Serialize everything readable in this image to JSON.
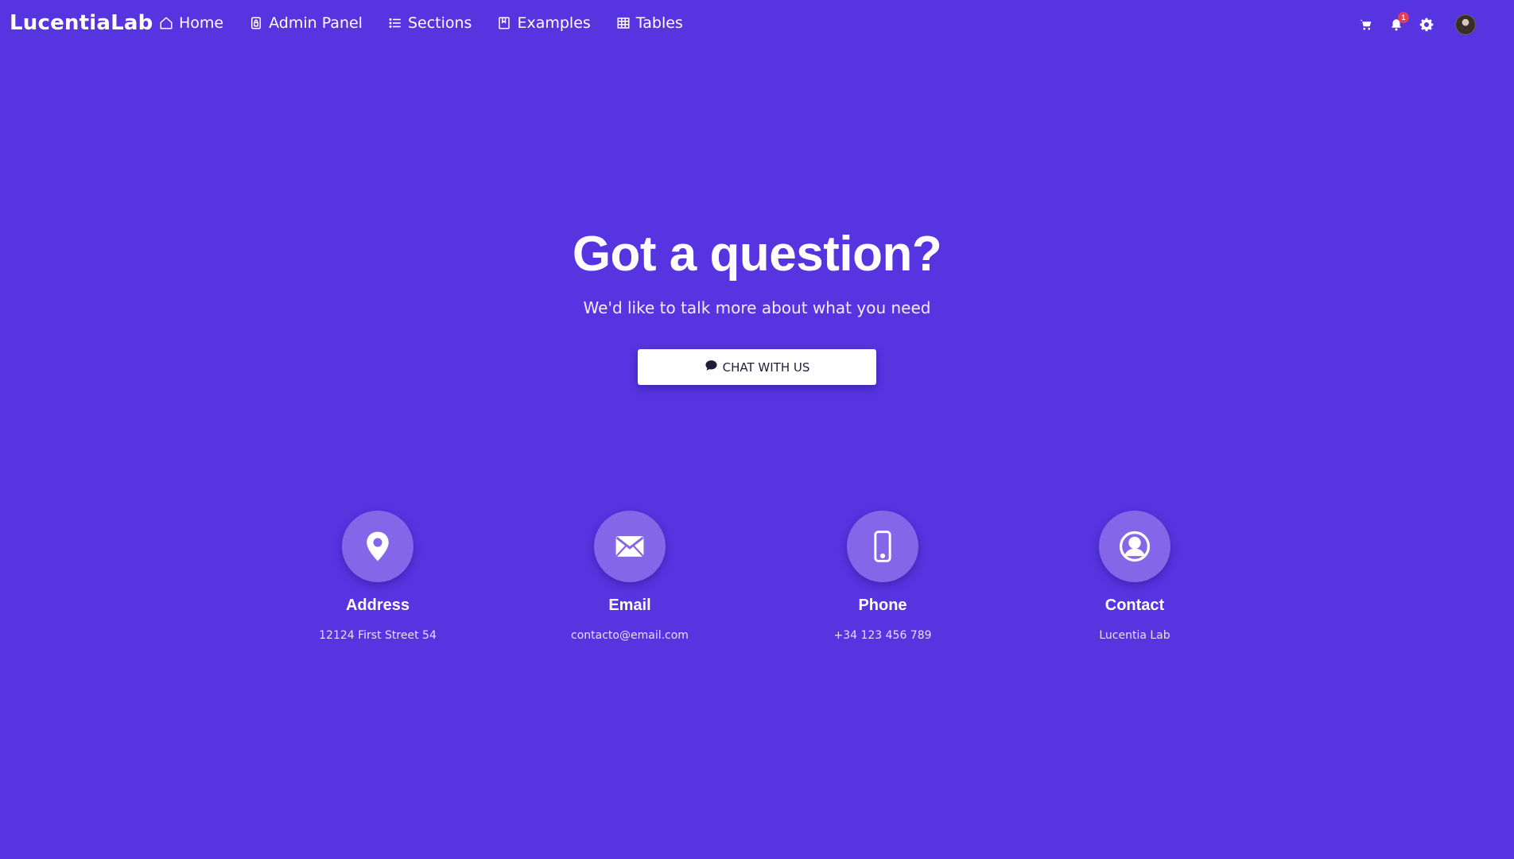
{
  "navbar": {
    "brand": "LucentiaLab",
    "links": [
      {
        "label": "Home",
        "icon": "home-icon"
      },
      {
        "label": "Admin Panel",
        "icon": "lock-icon"
      },
      {
        "label": "Sections",
        "icon": "list-icon"
      },
      {
        "label": "Examples",
        "icon": "book-icon"
      },
      {
        "label": "Tables",
        "icon": "table-icon"
      }
    ],
    "right_icons": [
      "cart-icon",
      "bell-icon",
      "gear-icon",
      "avatar"
    ],
    "notification_count": "1"
  },
  "hero": {
    "title": "Got a question?",
    "subtitle": "We'd like to talk more about what you need",
    "button_label": "CHAT WITH US",
    "button_icon": "chat-bubble-icon"
  },
  "info": [
    {
      "title": "Address",
      "text": "12124 First Street 54",
      "icon": "map-pin-icon"
    },
    {
      "title": "Email",
      "text": "contacto@email.com",
      "icon": "envelope-icon"
    },
    {
      "title": "Phone",
      "text": "+34 123 456 789",
      "icon": "phone-icon"
    },
    {
      "title": "Contact",
      "text": "Lucentia Lab",
      "icon": "user-circle-icon"
    }
  ],
  "colors": {
    "background": "#5634e0",
    "circle": "#8466e8",
    "badge": "#e53e5a",
    "button_bg": "#ffffff",
    "button_text": "#1e1e3a"
  }
}
